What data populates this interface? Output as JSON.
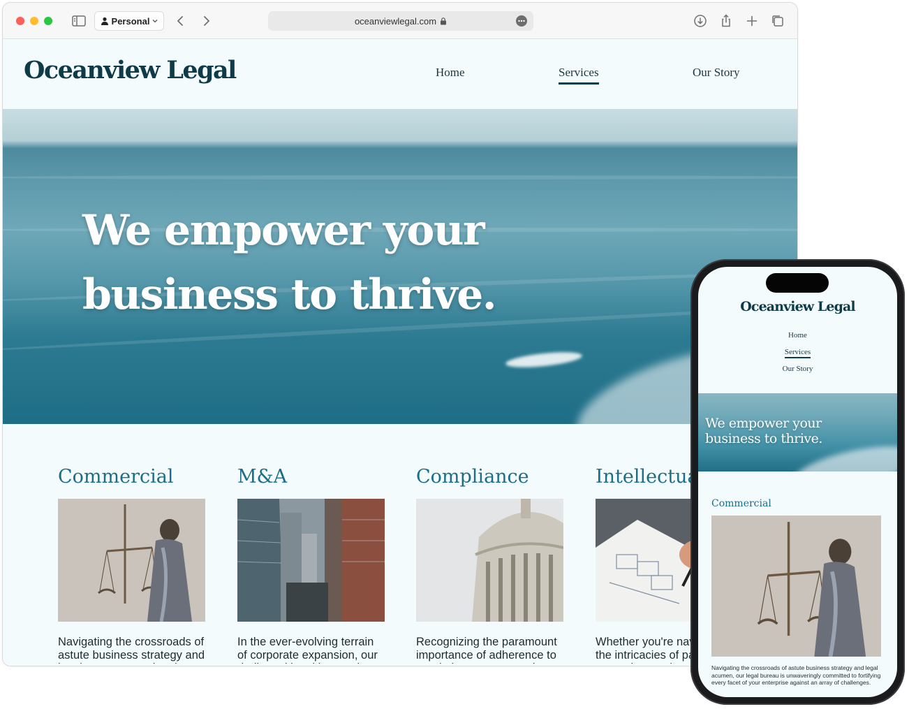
{
  "browser": {
    "profile_label": "Personal",
    "url": "oceanviewlegal.com"
  },
  "site": {
    "logo": "Oceanview Legal",
    "nav": [
      "Home",
      "Services",
      "Our Story"
    ],
    "active_nav": "Services",
    "hero_title": "We empower your business to thrive."
  },
  "services": [
    {
      "title": "Commercial",
      "image": "lady-justice-statue",
      "text": "Navigating the crossroads of astute business strategy and legal acumen, our legal"
    },
    {
      "title": "M&A",
      "image": "city-skyscrapers",
      "text": "In the ever-evolving terrain of corporate expansion, our dedicated legal bureau is"
    },
    {
      "title": "Compliance",
      "image": "capitol-dome",
      "text": "Recognizing the paramount importance of adherence to regulations, our extensive"
    },
    {
      "title": "Intellectual Property",
      "image": "hand-sketching-plans",
      "text": "Whether you're navigating the intricacies of patent protection, trademark"
    }
  ],
  "mobile": {
    "logo": "Oceanview Legal",
    "nav": [
      "Home",
      "Services",
      "Our Story"
    ],
    "hero_title": "We empower your business to thrive.",
    "service_title": "Commercial",
    "service_text": "Navigating the crossroads of astute business strategy and legal acumen, our legal bureau is unwaveringly committed to fortifying every facet of your enterprise against an array of challenges."
  },
  "colors": {
    "brand_dark": "#0f3b48",
    "accent_teal": "#1b6e85",
    "page_bg": "#f3fbfc"
  }
}
